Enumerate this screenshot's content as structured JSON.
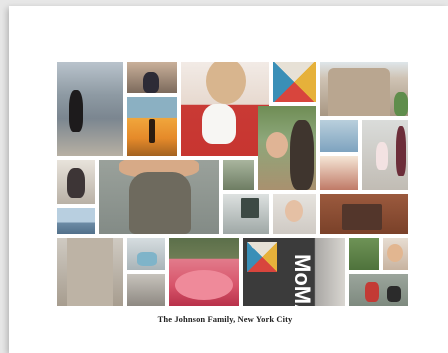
{
  "caption": "The Johnson Family, New York City",
  "signage": {
    "moma_logo": "MoMA"
  },
  "colors": {
    "page_background": "#e7e7e7",
    "sheet": "#ffffff",
    "caption_text": "#222222"
  }
}
